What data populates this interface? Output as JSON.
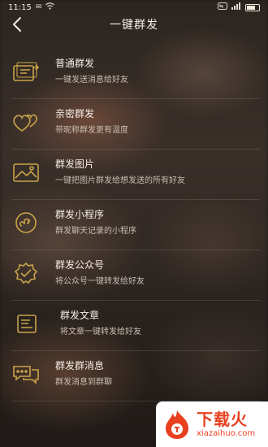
{
  "status": {
    "time": "11:15",
    "left_icons": [
      "notification-icon",
      "wifi-icon"
    ],
    "right_icons": [
      "nfc-icon",
      "signal-icon",
      "battery-icon"
    ]
  },
  "header": {
    "title": "一键群发"
  },
  "accent_color": "#c9a44a",
  "items": [
    {
      "icon": "broadcast-message-icon",
      "title": "普通群发",
      "subtitle": "一键发送消息给好友"
    },
    {
      "icon": "hearts-icon",
      "title": "亲密群发",
      "subtitle": "带昵称群发更有温度"
    },
    {
      "icon": "image-icon",
      "title": "群发图片",
      "subtitle": "一键把图片群发给想发送的所有好友"
    },
    {
      "icon": "mini-program-icon",
      "title": "群发小程序",
      "subtitle": "群发聊天记录的小程序"
    },
    {
      "icon": "official-account-icon",
      "title": "群发公众号",
      "subtitle": "将公众号一键转发给好友"
    },
    {
      "icon": "article-icon",
      "title": "群发文章",
      "subtitle": "将文章一键转发给好友"
    },
    {
      "icon": "group-chat-icon",
      "title": "群发群消息",
      "subtitle": "群发消息到群聊"
    }
  ],
  "watermark": {
    "brand": "下载火",
    "url": "xiazaihuo.com"
  }
}
